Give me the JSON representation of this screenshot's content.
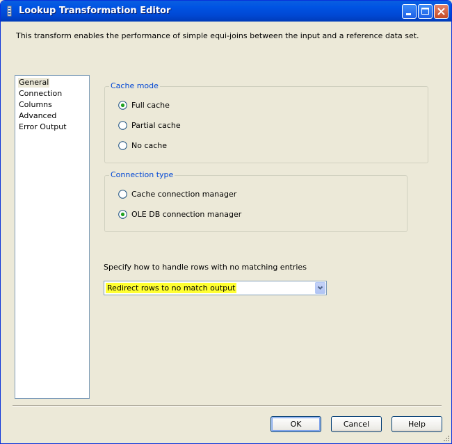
{
  "window": {
    "title": "Lookup Transformation Editor",
    "description": "This transform enables the performance of simple equi-joins between the input and a reference data set."
  },
  "nav": {
    "items": [
      {
        "label": "General",
        "selected": true
      },
      {
        "label": "Connection",
        "selected": false
      },
      {
        "label": "Columns",
        "selected": false
      },
      {
        "label": "Advanced",
        "selected": false
      },
      {
        "label": "Error Output",
        "selected": false
      }
    ]
  },
  "cache_mode": {
    "label": "Cache mode",
    "options": [
      {
        "label": "Full cache",
        "checked": true
      },
      {
        "label": "Partial cache",
        "checked": false
      },
      {
        "label": "No cache",
        "checked": false
      }
    ]
  },
  "connection_type": {
    "label": "Connection type",
    "options": [
      {
        "label": "Cache connection manager",
        "checked": false
      },
      {
        "label": "OLE DB connection manager",
        "checked": true
      }
    ]
  },
  "no_match": {
    "label": "Specify how to handle rows with no matching entries",
    "selected_value": "Redirect rows to no match output"
  },
  "buttons": {
    "ok": "OK",
    "cancel": "Cancel",
    "help": "Help"
  },
  "colors": {
    "titlebar": "#0054e3",
    "dialog_bg": "#ece9d8",
    "group_label": "#0046d5",
    "select_highlight": "#ffff33"
  }
}
